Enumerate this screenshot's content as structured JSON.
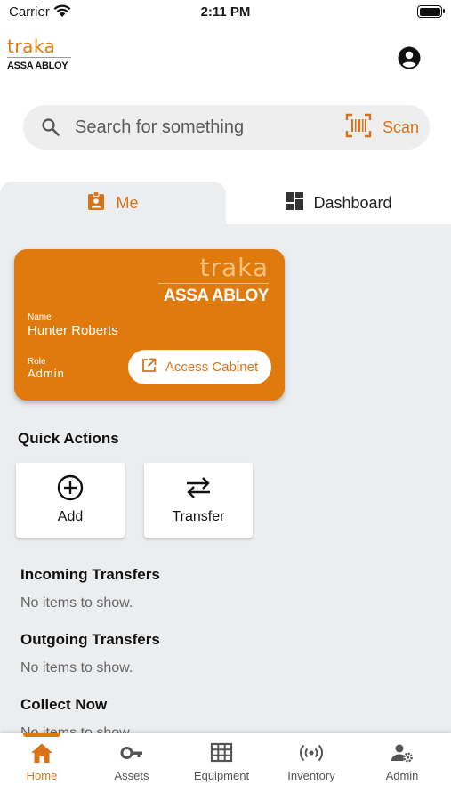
{
  "status_bar": {
    "carrier": "Carrier",
    "time": "2:11 PM"
  },
  "header": {
    "logo": {
      "brand": "traka",
      "sub": "ASSA ABLOY"
    },
    "account_icon": "account-circle-icon"
  },
  "search": {
    "placeholder": "Search for something",
    "scan_label": "Scan"
  },
  "tabs": [
    {
      "label": "Me",
      "icon": "badge-icon",
      "active": true
    },
    {
      "label": "Dashboard",
      "icon": "dashboard-icon",
      "active": false
    }
  ],
  "card": {
    "brand": "traka",
    "brand_sub": "ASSA ABLOY",
    "name_label": "Name",
    "name": "Hunter Roberts",
    "role_label": "Role",
    "role": "Admin",
    "button_label": "Access Cabinet"
  },
  "quick_actions": {
    "title": "Quick Actions",
    "items": [
      {
        "label": "Add",
        "icon": "add-circle-icon"
      },
      {
        "label": "Transfer",
        "icon": "transfer-arrows-icon"
      }
    ]
  },
  "sections": [
    {
      "title": "Incoming Transfers",
      "empty": "No items to show."
    },
    {
      "title": "Outgoing Transfers",
      "empty": "No items to show."
    },
    {
      "title": "Collect Now",
      "empty": "No items to show."
    }
  ],
  "nav": [
    {
      "label": "Home",
      "icon": "home-icon",
      "active": true
    },
    {
      "label": "Assets",
      "icon": "key-icon",
      "active": false
    },
    {
      "label": "Equipment",
      "icon": "grid-icon",
      "active": false
    },
    {
      "label": "Inventory",
      "icon": "rfid-icon",
      "active": false
    },
    {
      "label": "Admin",
      "icon": "admin-settings-icon",
      "active": false
    }
  ],
  "colors": {
    "accent": "#e07a0c",
    "surface": "#ecedef"
  }
}
